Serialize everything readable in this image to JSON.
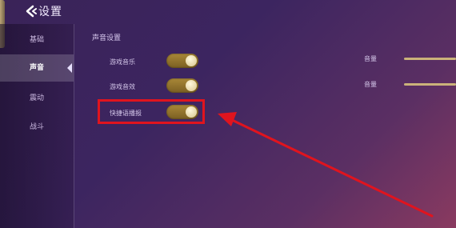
{
  "header": {
    "title": "设置",
    "back_icon": "chevron-left-icon"
  },
  "sidebar": {
    "items": [
      {
        "label": "基础"
      },
      {
        "label": "声音",
        "active": true
      },
      {
        "label": "震动"
      },
      {
        "label": "战斗"
      }
    ]
  },
  "sound": {
    "section_title": "声音设置",
    "rows": [
      {
        "label": "游戏音乐",
        "on": true
      },
      {
        "label": "游戏音效",
        "on": true
      },
      {
        "label": "快捷语播报",
        "on": true
      }
    ],
    "volume_label_1": "音量",
    "volume_label_2": "音量"
  },
  "colors": {
    "highlight": "#e0141e",
    "toggle_on": "#a98838"
  }
}
